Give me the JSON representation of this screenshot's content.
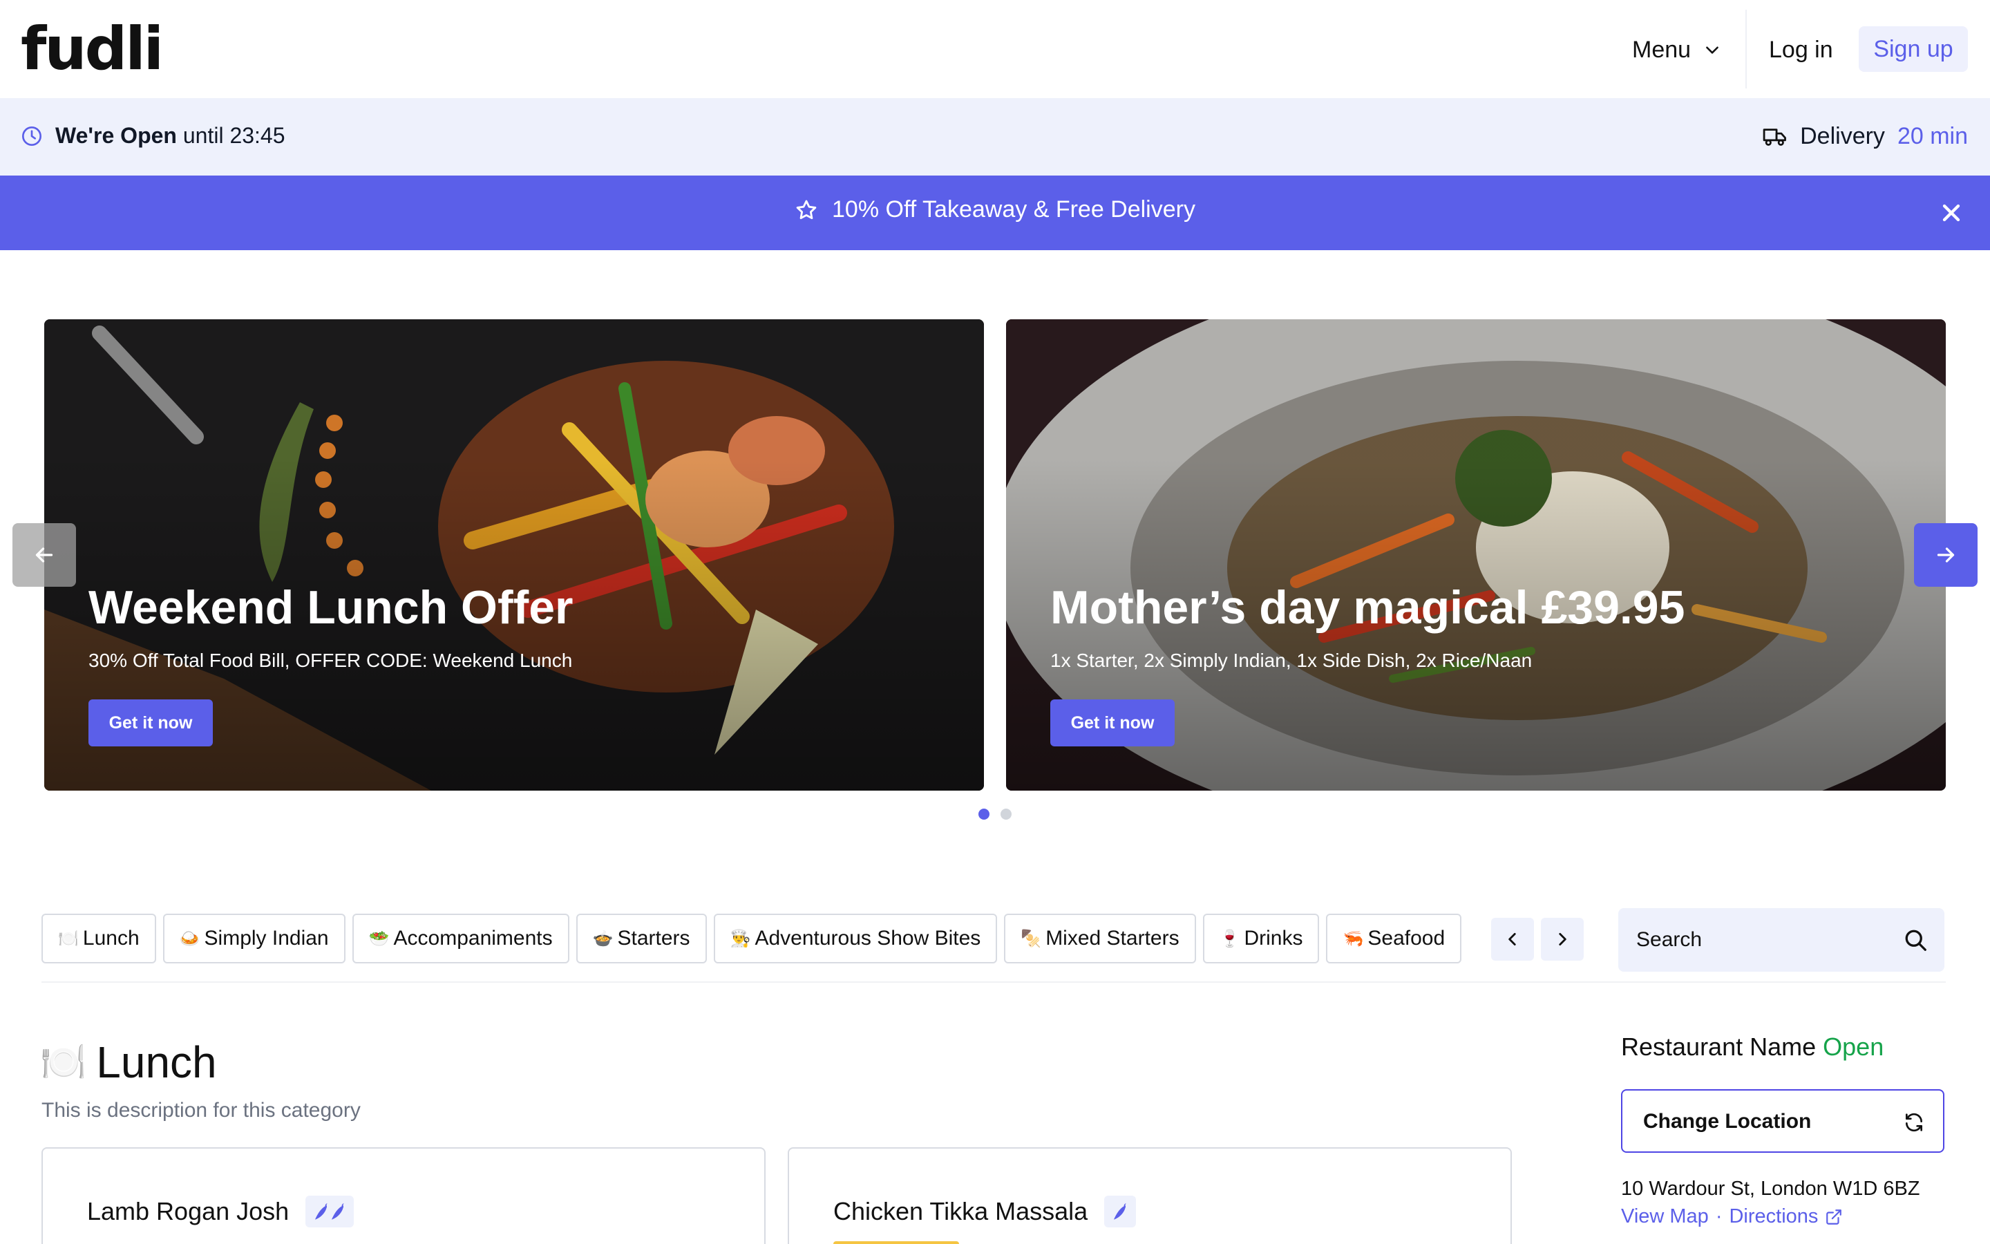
{
  "header": {
    "logo": "fudli",
    "menu_label": "Menu",
    "login_label": "Log in",
    "signup_label": "Sign up"
  },
  "status": {
    "open_label": "We're Open",
    "open_until": "until 23:45",
    "delivery_label": "Delivery",
    "delivery_time": "20 min"
  },
  "promo": {
    "text": "10% Off Takeaway & Free Delivery",
    "icon": "star-icon"
  },
  "carousel": {
    "slides": [
      {
        "title": "Weekend Lunch Offer",
        "subtitle": "30% Off Total Food Bill, OFFER CODE: Weekend Lunch",
        "cta": "Get it now"
      },
      {
        "title": "Mother’s day magical £39.95",
        "subtitle": "1x Starter, 2x Simply Indian, 1x Side Dish, 2x Rice/Naan",
        "cta": "Get it now"
      }
    ],
    "active_index": 0,
    "dot_count": 2
  },
  "categories": [
    {
      "emoji": "🍽️",
      "label": "Lunch"
    },
    {
      "emoji": "🍛",
      "label": "Simply Indian"
    },
    {
      "emoji": "🥗",
      "label": "Accompaniments"
    },
    {
      "emoji": "🍲",
      "label": "Starters"
    },
    {
      "emoji": "👨‍🍳",
      "label": "Adventurous Show Bites"
    },
    {
      "emoji": "🍢",
      "label": "Mixed Starters"
    },
    {
      "emoji": "🍷",
      "label": "Drinks"
    },
    {
      "emoji": "🦐",
      "label": "Seafood"
    }
  ],
  "search": {
    "placeholder": "Search"
  },
  "section": {
    "emoji": "🍽️",
    "title": "Lunch",
    "description": "This is description for this category"
  },
  "items": [
    {
      "name": "Lamb Rogan Josh",
      "spice_level": 2
    },
    {
      "name": "Chicken Tikka Massala",
      "spice_level": 1
    }
  ],
  "restaurant": {
    "name": "Restaurant Name",
    "status": "Open",
    "change_location": "Change Location",
    "address": "10 Wardour St, London W1D 6BZ",
    "view_map": "View Map",
    "separator": "·",
    "directions": "Directions"
  },
  "colors": {
    "accent": "#5b5fe9",
    "status_bar_bg": "#eef1fc",
    "open_green": "#16a34a"
  }
}
